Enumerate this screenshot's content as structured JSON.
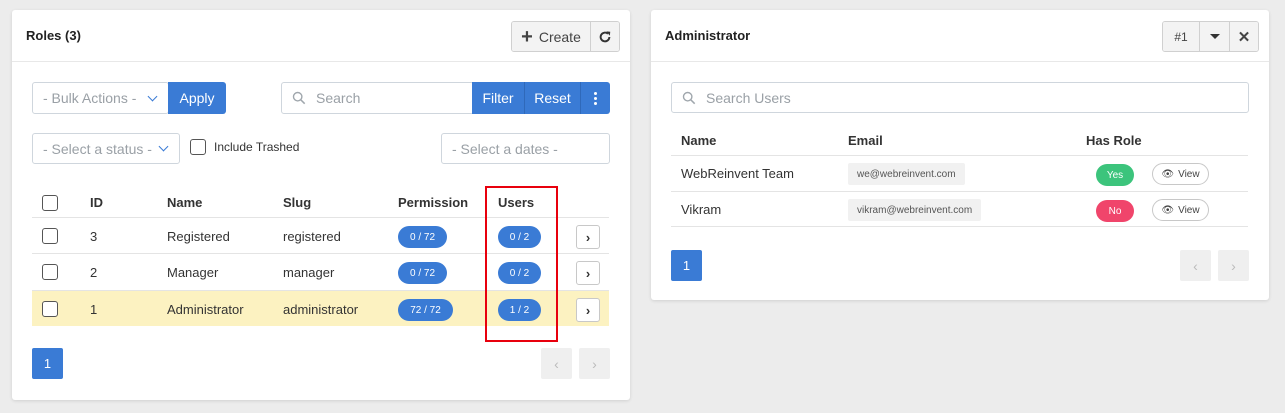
{
  "roles_panel": {
    "title": "Roles (3)",
    "create_label": "Create",
    "bulk_actions": "- Bulk Actions -",
    "apply_label": "Apply",
    "search_placeholder": "Search",
    "filter_label": "Filter",
    "reset_label": "Reset",
    "status_select": "- Select a status -",
    "include_trashed": "Include Trashed",
    "dates_placeholder": "- Select a dates -",
    "columns": [
      "ID",
      "Name",
      "Slug",
      "Permission",
      "Users"
    ],
    "rows": [
      {
        "id": "3",
        "name": "Registered",
        "slug": "registered",
        "permission": "0 / 72",
        "users": "0 / 2"
      },
      {
        "id": "2",
        "name": "Manager",
        "slug": "manager",
        "permission": "0 / 72",
        "users": "0 / 2"
      },
      {
        "id": "1",
        "name": "Administrator",
        "slug": "administrator",
        "permission": "72 / 72",
        "users": "1 / 2"
      }
    ],
    "page": "1"
  },
  "admin_panel": {
    "title": "Administrator",
    "id_label": "#1",
    "search_placeholder": "Search Users",
    "columns": [
      "Name",
      "Email",
      "Has Role"
    ],
    "rows": [
      {
        "name": "WebReinvent Team",
        "email": "we@webreinvent.com",
        "has_role": "Yes",
        "view": "View"
      },
      {
        "name": "Vikram",
        "email": "vikram@webreinvent.com",
        "has_role": "No",
        "view": "View"
      }
    ],
    "page": "1"
  },
  "colors": {
    "primary": "#3a7bd5",
    "yes": "#3cc47c",
    "no": "#f0456b",
    "highlight_row": "#fcf2c1",
    "annotation": "#e8000d"
  }
}
